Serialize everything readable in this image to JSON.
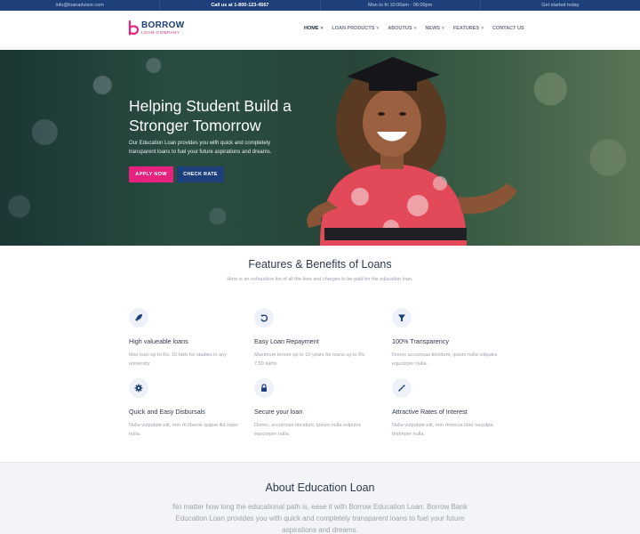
{
  "topbar": {
    "email": "info@loanadvisor.com",
    "phone": "Call us at 1-800-123-4567",
    "hours": "Mon to fri 10:00am - 06:00pm",
    "cta": "Get started today"
  },
  "brand": {
    "name": "BORROW",
    "tagline": "LOAN-COMPANY",
    "colors": {
      "navy": "#1d3f7a",
      "pink": "#e5237f"
    }
  },
  "nav": {
    "items": [
      {
        "label": "HOME",
        "chevron": true,
        "active": true
      },
      {
        "label": "LOAN PRODUCTS",
        "chevron": true
      },
      {
        "label": "ABOUTUS",
        "chevron": true
      },
      {
        "label": "NEWS",
        "chevron": true
      },
      {
        "label": "FEATURES",
        "chevron": true
      },
      {
        "label": "CONTACT US",
        "chevron": false
      }
    ]
  },
  "hero": {
    "title_line1": "Helping Student Build a",
    "title_line2": "Stronger Tomorrow",
    "text": "Our Education Loan provides you with quick and completely transparent loans to fuel your future aspirations and dreams.",
    "apply_label": "APPLY NOW",
    "rate_label": "CHECK RATE"
  },
  "features": {
    "title": "Features & Benefits of Loans",
    "subtitle": "Here is an exhaustive list of all the fees and charges to be-paid for the education loan.",
    "items": [
      {
        "icon": "rocket-icon",
        "title": "High valueable loans",
        "text": "Max loan up to Rs. 10 lakh for studies in any university"
      },
      {
        "icon": "refresh-icon",
        "title": "Easy Loan Repayment",
        "text": "Maximum tenure up to 10 years for loans up to Rs. 7.50 lakhs"
      },
      {
        "icon": "filter-icon",
        "title": "100% Transparency",
        "text": "Donec accumsax tincidunt, ipsum nulla vulputra equcorper nulla."
      },
      {
        "icon": "gear-icon",
        "title": "Quick and Easy Disbursals",
        "text": "Nulla vulputate elit, non rh liberoe qutpat ilid orper nulla."
      },
      {
        "icon": "lock-icon",
        "title": "Secure your loan",
        "text": "Donec, accumsax tincidunt, ipsum nulla vulputra equcorper nulla."
      },
      {
        "icon": "magic-wand-icon",
        "title": "Attractive Rates of Interest",
        "text": "Nulla vulputate elit, non rhoncus liber oequtpa tlndorper nulla."
      }
    ]
  },
  "about": {
    "title": "About Education Loan",
    "text": "No matter how long the educational path is, ease it with Borrow Education Loan. Borrow Bank Education Loan provides you with quick and completely transparent loans to fuel your future aspirations and dreams."
  }
}
